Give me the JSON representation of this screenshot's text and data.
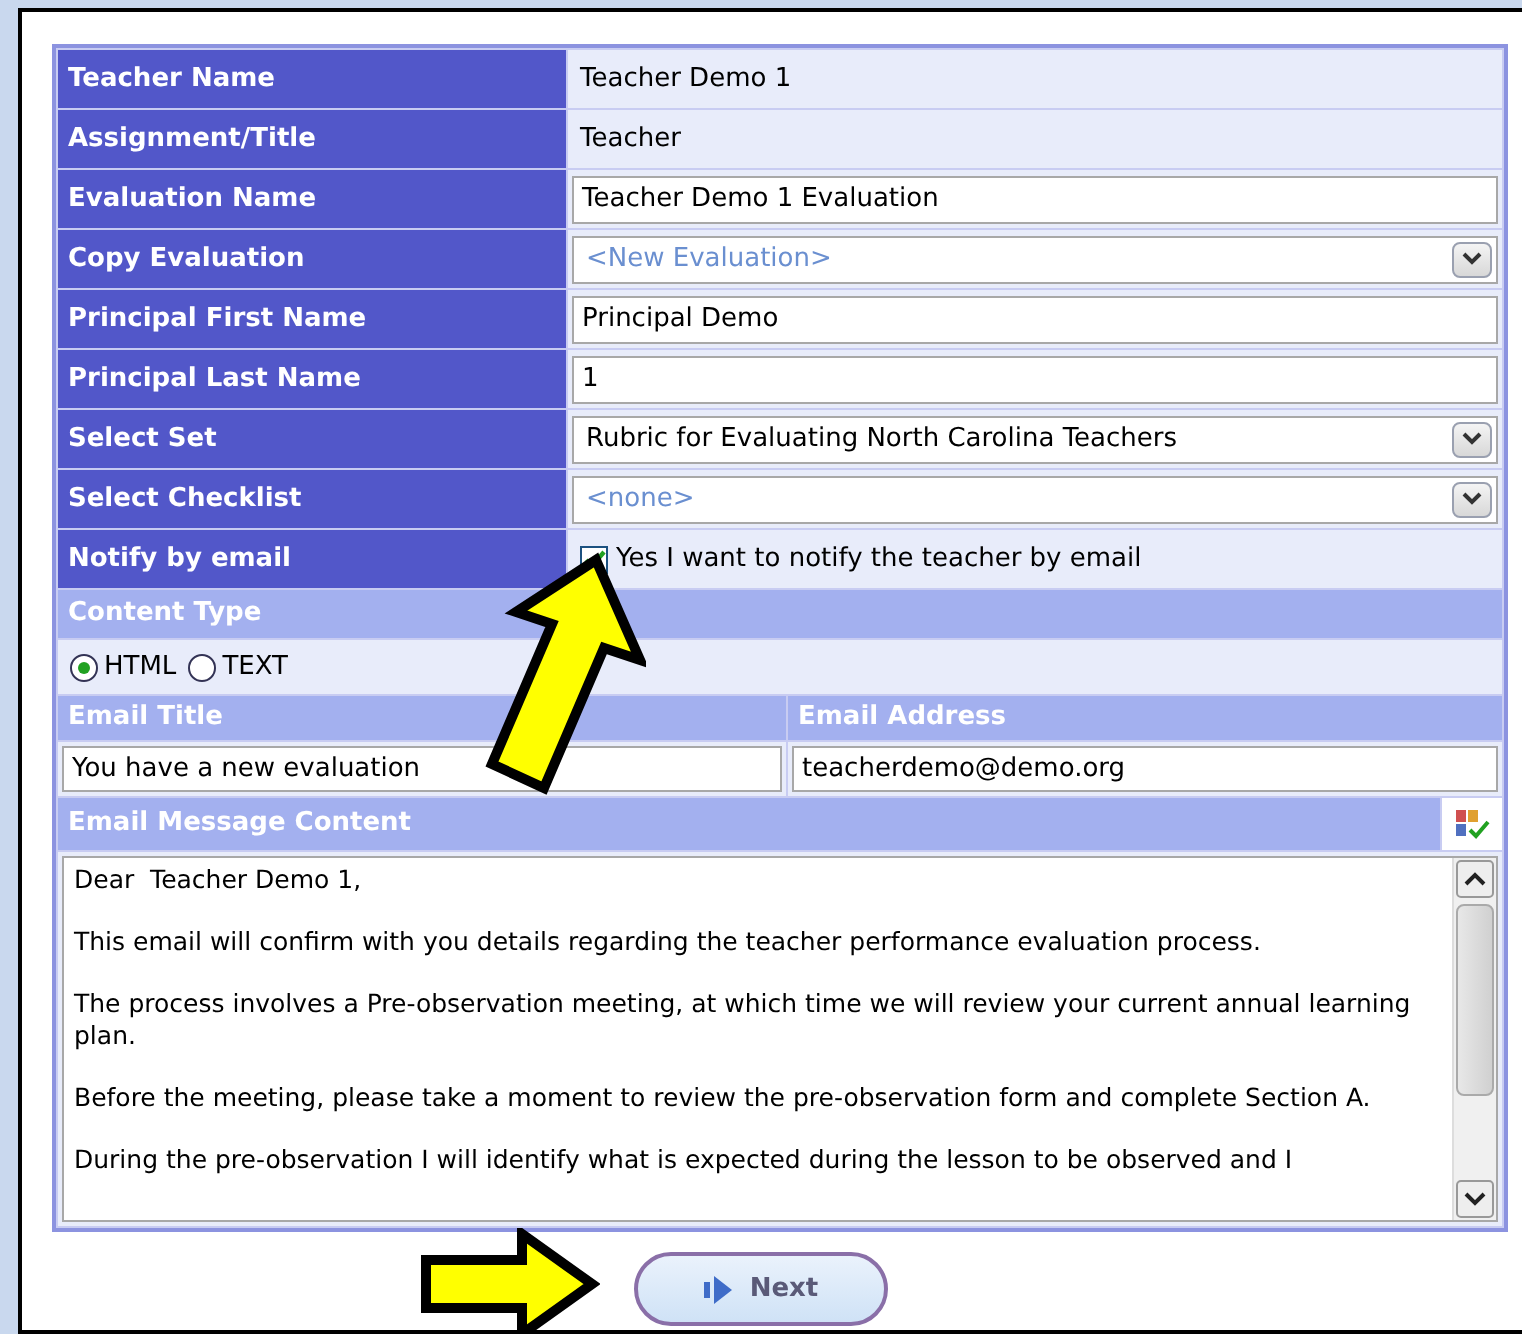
{
  "fields": [
    {
      "kind": "static",
      "label": "Teacher Name",
      "value": "Teacher Demo 1"
    },
    {
      "kind": "static",
      "label": "Assignment/Title",
      "value": "Teacher"
    },
    {
      "kind": "input",
      "label": "Evaluation Name",
      "value": "Teacher Demo 1 Evaluation"
    },
    {
      "kind": "select",
      "label": "Copy Evaluation",
      "value": "<New Evaluation>",
      "dimmed": true
    },
    {
      "kind": "input",
      "label": "Principal First Name",
      "value": "Principal Demo"
    },
    {
      "kind": "input",
      "label": "Principal Last Name",
      "value": "1"
    },
    {
      "kind": "select",
      "label": "Select Set",
      "value": "Rubric for Evaluating North Carolina Teachers",
      "dimmed": false
    },
    {
      "kind": "select",
      "label": "Select Checklist",
      "value": "<none>",
      "dimmed": true
    },
    {
      "kind": "checkbox",
      "label": "Notify by email",
      "value": "Yes I want to notify the teacher by email",
      "checked": true
    }
  ],
  "content_type": {
    "header": "Content Type",
    "options": [
      {
        "label": "HTML",
        "selected": true
      },
      {
        "label": "TEXT",
        "selected": false
      }
    ]
  },
  "email": {
    "title_header": "Email Title",
    "address_header": "Email Address",
    "title": "You have a new evaluation",
    "address": "teacherdemo@demo.org"
  },
  "message": {
    "header": "Email Message Content",
    "paragraphs": [
      "Dear  Teacher Demo 1,",
      "This email will confirm with you details regarding the teacher performance evaluation process.",
      "The process involves a Pre-observation meeting, at which time we will review your current annual learning plan.",
      "Before the meeting, please take a moment to review the pre-observation form and complete Section A.",
      "During the pre-observation I will identify what is expected during the lesson to be observed and I"
    ]
  },
  "next_button": "Next"
}
